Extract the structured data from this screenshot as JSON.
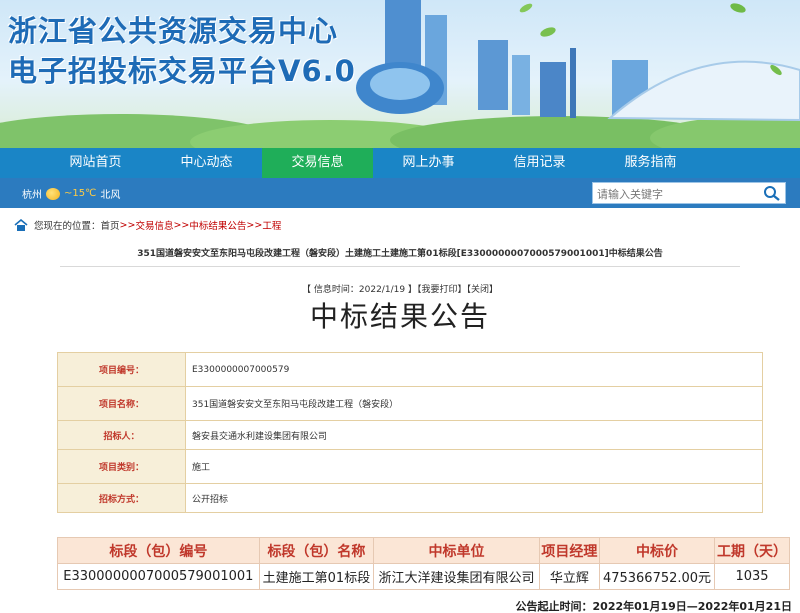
{
  "banner": {
    "title_line1": "浙江省公共资源交易中心",
    "title_line2": "电子招投标交易平台V6.0"
  },
  "nav": {
    "items": [
      {
        "label": "网站首页"
      },
      {
        "label": "中心动态"
      },
      {
        "label": "交易信息"
      },
      {
        "label": "网上办事"
      },
      {
        "label": "信用记录"
      },
      {
        "label": "服务指南"
      }
    ],
    "active_index": 2,
    "active_color": "#1fae59",
    "bar_color": "#1a85c6"
  },
  "weather": {
    "city": "杭州",
    "temperature": "~15℃",
    "wind": "北风"
  },
  "search": {
    "placeholder": "请输入关键字"
  },
  "breadcrumb": {
    "prefix": "您现在的位置：",
    "home": "首页",
    "sep": " >> ",
    "items": [
      "交易信息",
      "中标结果公告",
      "工程"
    ]
  },
  "notice": {
    "heading": "351国道磐安安文至东阳马屯段改建工程（磐安段）土建施工土建施工第01标段[E3300000007000579001001]中标结果公告",
    "info_prefix": "【 信息时间：",
    "info_date": "2022/1/19",
    "info_suffix": " 】",
    "print_link": "【我要打印】",
    "close_link": "【关闭】",
    "title": "中标结果公告"
  },
  "project": {
    "rows": [
      {
        "key": "项目编号：",
        "value": "E3300000007000579"
      },
      {
        "key": "项目名称：",
        "value": "351国道磐安安文至东阳马屯段改建工程（磐安段）"
      },
      {
        "key": "招标人：",
        "value": "磐安县交通水利建设集团有限公司"
      },
      {
        "key": "项目类别：",
        "value": "施工"
      },
      {
        "key": "招标方式：",
        "value": "公开招标"
      }
    ]
  },
  "bid_table": {
    "headers": [
      "标段（包）编号",
      "标段（包）名称",
      "中标单位",
      "项目经理",
      "中标价",
      "工期（天）"
    ],
    "rows": [
      [
        "E3300000007000579001001",
        "土建施工第01标段",
        "浙江大洋建设集团有限公司",
        "华立辉",
        "475366752.00元",
        "1035"
      ]
    ]
  },
  "period": {
    "label": "公告起止时间：",
    "value": "2022年01月19日—2022年01月21日"
  }
}
